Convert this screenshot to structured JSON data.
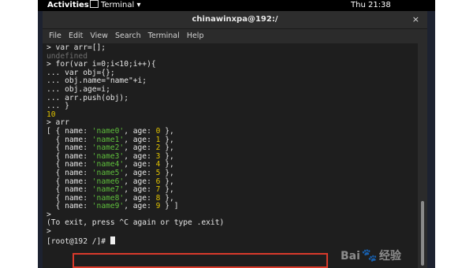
{
  "topbar": {
    "activities": "Activities",
    "app_menu": "Terminal ▾",
    "clock": "Thu 21:38"
  },
  "window": {
    "title": "chinawinxpa@192:/",
    "close": "×"
  },
  "menu": [
    "File",
    "Edit",
    "View",
    "Search",
    "Terminal",
    "Help"
  ],
  "terminal": {
    "lines": [
      [
        {
          "t": "> var arr=[];"
        }
      ],
      [
        {
          "t": "undefined",
          "c": "grey"
        }
      ],
      [
        {
          "t": "> for(var i=0;i<10;i++){"
        }
      ],
      [
        {
          "t": "... var obj={};"
        }
      ],
      [
        {
          "t": "... obj.name=\"name\"+i;"
        }
      ],
      [
        {
          "t": "... obj.age=i;"
        }
      ],
      [
        {
          "t": "... arr.push(obj);"
        }
      ],
      [
        {
          "t": "... }"
        }
      ],
      [
        {
          "t": "10",
          "c": "yellow"
        }
      ],
      [
        {
          "t": "> arr"
        }
      ],
      [
        {
          "t": "[ { name: "
        },
        {
          "t": "'name0'",
          "c": "green"
        },
        {
          "t": ", age: "
        },
        {
          "t": "0",
          "c": "yellow"
        },
        {
          "t": " },"
        }
      ],
      [
        {
          "t": "  { name: "
        },
        {
          "t": "'name1'",
          "c": "green"
        },
        {
          "t": ", age: "
        },
        {
          "t": "1",
          "c": "yellow"
        },
        {
          "t": " },"
        }
      ],
      [
        {
          "t": "  { name: "
        },
        {
          "t": "'name2'",
          "c": "green"
        },
        {
          "t": ", age: "
        },
        {
          "t": "2",
          "c": "yellow"
        },
        {
          "t": " },"
        }
      ],
      [
        {
          "t": "  { name: "
        },
        {
          "t": "'name3'",
          "c": "green"
        },
        {
          "t": ", age: "
        },
        {
          "t": "3",
          "c": "yellow"
        },
        {
          "t": " },"
        }
      ],
      [
        {
          "t": "  { name: "
        },
        {
          "t": "'name4'",
          "c": "green"
        },
        {
          "t": ", age: "
        },
        {
          "t": "4",
          "c": "yellow"
        },
        {
          "t": " },"
        }
      ],
      [
        {
          "t": "  { name: "
        },
        {
          "t": "'name5'",
          "c": "green"
        },
        {
          "t": ", age: "
        },
        {
          "t": "5",
          "c": "yellow"
        },
        {
          "t": " },"
        }
      ],
      [
        {
          "t": "  { name: "
        },
        {
          "t": "'name6'",
          "c": "green"
        },
        {
          "t": ", age: "
        },
        {
          "t": "6",
          "c": "yellow"
        },
        {
          "t": " },"
        }
      ],
      [
        {
          "t": "  { name: "
        },
        {
          "t": "'name7'",
          "c": "green"
        },
        {
          "t": ", age: "
        },
        {
          "t": "7",
          "c": "yellow"
        },
        {
          "t": " },"
        }
      ],
      [
        {
          "t": "  { name: "
        },
        {
          "t": "'name8'",
          "c": "green"
        },
        {
          "t": ", age: "
        },
        {
          "t": "8",
          "c": "yellow"
        },
        {
          "t": " },"
        }
      ],
      [
        {
          "t": "  { name: "
        },
        {
          "t": "'name9'",
          "c": "green"
        },
        {
          "t": ", age: "
        },
        {
          "t": "9",
          "c": "yellow"
        },
        {
          "t": " } ]"
        }
      ],
      [
        {
          "t": ">"
        }
      ],
      [
        {
          "t": "(To exit, press ^C again or type .exit)"
        }
      ],
      [
        {
          "t": ">"
        }
      ]
    ],
    "prompt": "[root@192 /]# "
  },
  "watermark": "Bai",
  "watermark_suffix": "经验",
  "colors": {
    "terminal_bg": "#1e1e1e",
    "string": "#5fbf3c",
    "number": "#e0c200",
    "undefined": "#6f6f6f",
    "highlight_box": "#d83a2b"
  }
}
